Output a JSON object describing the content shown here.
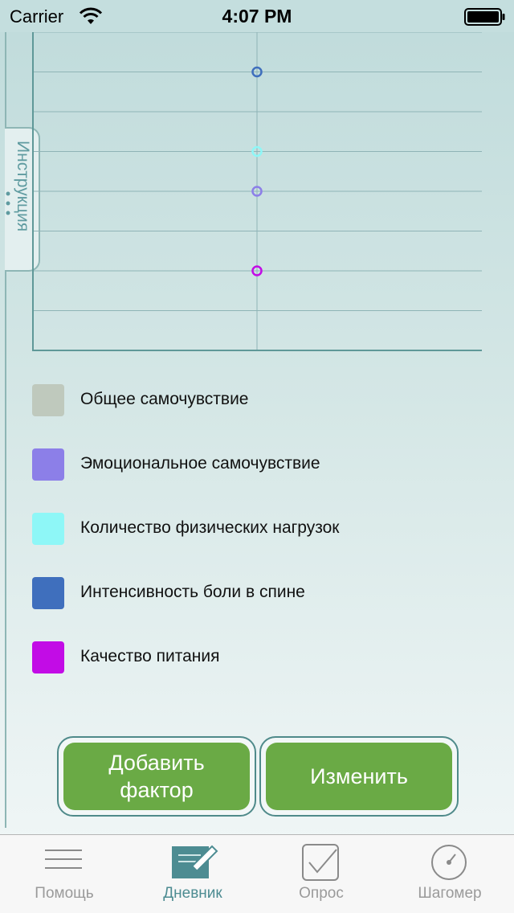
{
  "status": {
    "carrier": "Carrier",
    "time": "4:07 PM"
  },
  "side_tab": {
    "label": "Инструкция"
  },
  "chart_data": {
    "type": "scatter",
    "x": [
      0.5
    ],
    "ylim": [
      0,
      8
    ],
    "grid": true,
    "series": [
      {
        "name": "Общее самочувствие",
        "color": "#bfc9bd",
        "values": []
      },
      {
        "name": "Эмоциональное самочувствие",
        "color": "#8c7fe8",
        "values": [
          4
        ]
      },
      {
        "name": "Количество физических нагрузок",
        "color": "#8ef7f7",
        "values": [
          5
        ]
      },
      {
        "name": "Интенсивность боли в спине",
        "color": "#3f6fbd",
        "values": [
          7
        ]
      },
      {
        "name": "Качество питания",
        "color": "#c20ce6",
        "values": [
          2
        ]
      }
    ]
  },
  "legend": {
    "items": [
      {
        "label": "Общее самочувствие",
        "color": "#bfc9bd"
      },
      {
        "label": "Эмоциональное самочувствие",
        "color": "#8c7fe8"
      },
      {
        "label": "Количество физических нагрузок",
        "color": "#8ef7f7"
      },
      {
        "label": "Интенсивность боли в спине",
        "color": "#3f6fbd"
      },
      {
        "label": "Качество питания",
        "color": "#c20ce6"
      }
    ]
  },
  "buttons": {
    "add_factor": "Добавить\nфактор",
    "edit": "Изменить"
  },
  "tabs": [
    {
      "label": "Помощь",
      "icon": "menu-icon"
    },
    {
      "label": "Дневник",
      "icon": "diary-icon"
    },
    {
      "label": "Опрос",
      "icon": "checkbox-icon"
    },
    {
      "label": "Шагомер",
      "icon": "gauge-icon"
    }
  ]
}
